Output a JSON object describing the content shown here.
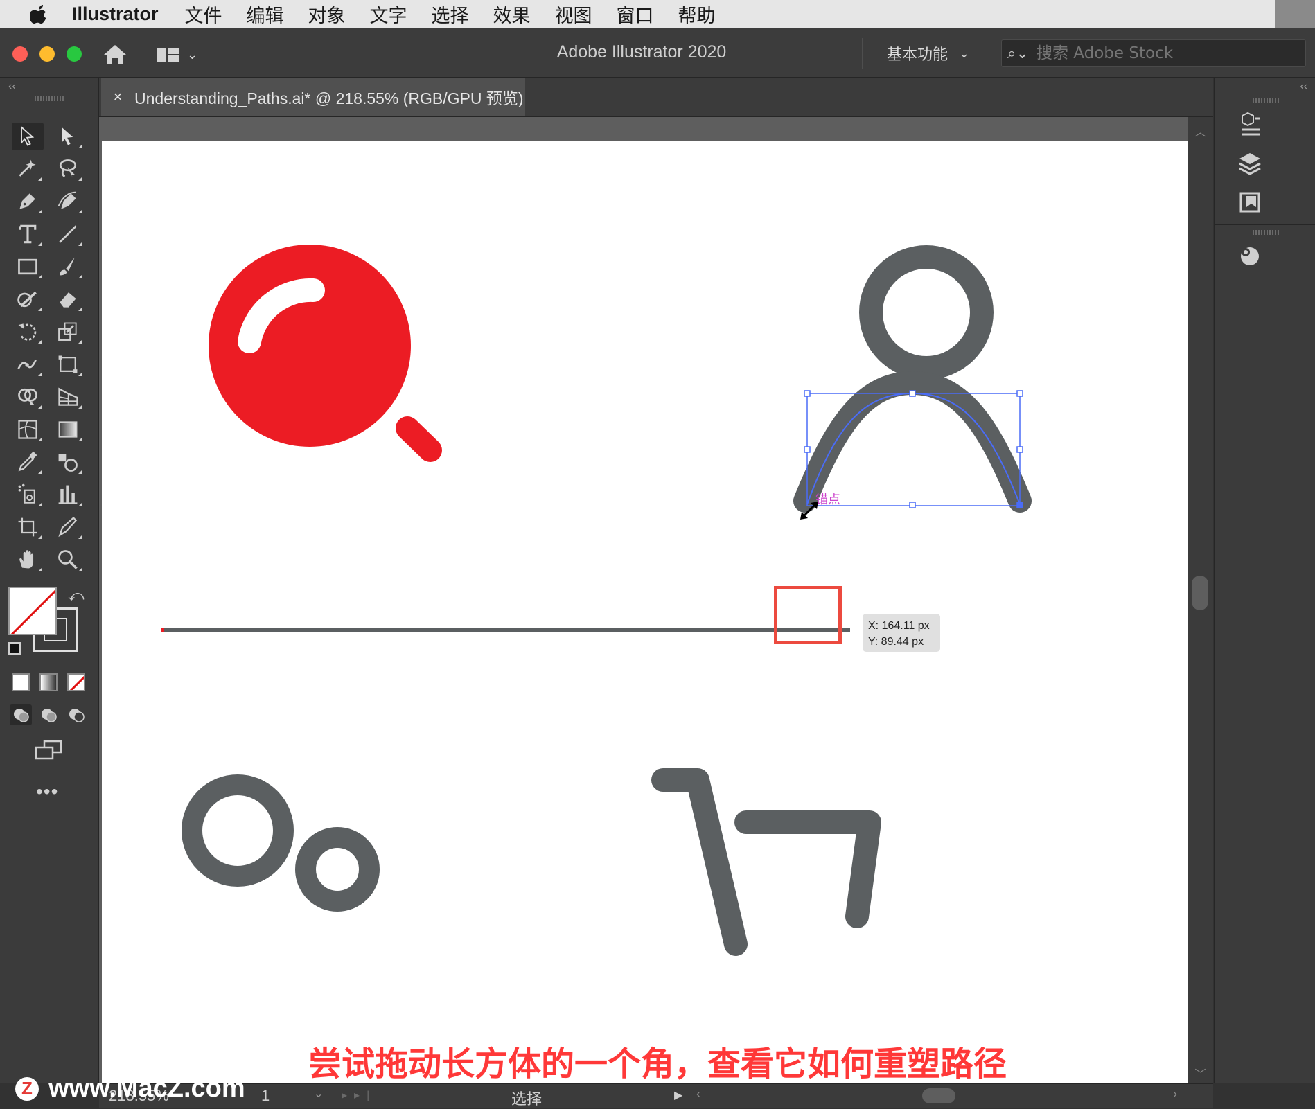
{
  "menubar": {
    "app_name": "Illustrator",
    "items": [
      "文件",
      "编辑",
      "对象",
      "文字",
      "选择",
      "效果",
      "视图",
      "窗口",
      "帮助"
    ]
  },
  "appbar": {
    "title": "Adobe Illustrator 2020",
    "workspace": "基本功能",
    "stock_placeholder": "搜索 Adobe Stock"
  },
  "document": {
    "tab_label": "Understanding_Paths.ai* @ 218.55% (RGB/GPU 预览)",
    "close_glyph": "×"
  },
  "tools": [
    "selection-tool",
    "direct-selection-tool",
    "magic-wand-tool",
    "lasso-tool",
    "pen-tool",
    "curvature-tool",
    "type-tool",
    "line-segment-tool",
    "rectangle-tool",
    "paintbrush-tool",
    "shaper-tool",
    "eraser-tool",
    "rotate-tool",
    "scale-tool",
    "width-tool",
    "free-transform-tool",
    "shape-builder-tool",
    "perspective-grid-tool",
    "mesh-tool",
    "gradient-tool",
    "eyedropper-tool",
    "blend-tool",
    "symbol-sprayer-tool",
    "column-graph-tool",
    "artboard-tool",
    "slice-tool",
    "hand-tool",
    "zoom-tool"
  ],
  "transform_readout": {
    "x": "X: 164.11 px",
    "y": "Y: 89.44 px"
  },
  "anchor_hint": "锚点",
  "statusbar": {
    "zoom": "218.55%",
    "page": "1",
    "mode": "选择"
  },
  "subtitle": "尝试拖动长方体的一个角，查看它如何重塑路径",
  "watermark": {
    "logo_letter": "Z",
    "text": "www.MacZ.com"
  },
  "colors": {
    "accent_red": "#ec1c24",
    "icon_gray": "#5b5f61",
    "selection_blue": "#4a6cf7",
    "highlight_box": "#ec4a3f"
  }
}
